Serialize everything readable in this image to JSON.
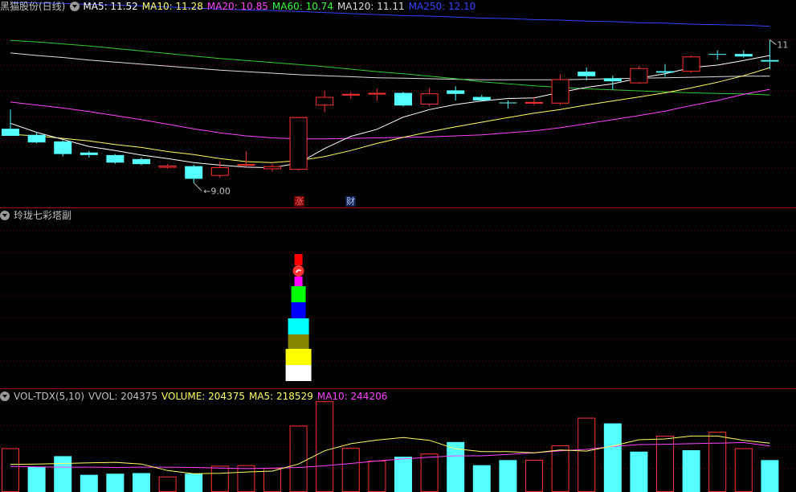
{
  "panels": {
    "price": {
      "title": "黑猫股份(日线)",
      "ma": [
        {
          "label": "MA5: 11.52",
          "color": "#ffffff"
        },
        {
          "label": "MA10: 11.28",
          "color": "#ffff66"
        },
        {
          "label": "MA20: 10.85",
          "color": "#ff44ff"
        },
        {
          "label": "MA60: 10.74",
          "color": "#33ff33"
        },
        {
          "label": "MA120: 11.11",
          "color": "#dddddd"
        },
        {
          "label": "MA250: 12.10",
          "color": "#3344ff"
        }
      ],
      "low_marker": "9.00",
      "high_marker": "11",
      "tag_zhang": "涨",
      "tag_cai": "财"
    },
    "tower": {
      "title": "玲珑七彩塔副"
    },
    "volume": {
      "title": "VOL-TDX(5,10)",
      "vvol": "VVOL: 204375",
      "volume": "VOLUME: 204375",
      "ma5": "MA5: 218529",
      "ma10": "MA10: 244206"
    }
  },
  "colors": {
    "up": "#ff3232",
    "down": "#54ffff",
    "grid": "#7a0000"
  },
  "chart_data": {
    "type": "candlestick",
    "ylim": [
      8.8,
      12.3
    ],
    "candles": [
      {
        "o": 10.07,
        "c": 9.93,
        "h": 10.45,
        "l": 9.93
      },
      {
        "o": 9.95,
        "c": 9.8,
        "h": 10.0,
        "l": 9.78
      },
      {
        "o": 9.82,
        "c": 9.57,
        "h": 9.84,
        "l": 9.52
      },
      {
        "o": 9.6,
        "c": 9.55,
        "h": 9.63,
        "l": 9.5
      },
      {
        "o": 9.55,
        "c": 9.4,
        "h": 9.57,
        "l": 9.38
      },
      {
        "o": 9.47,
        "c": 9.37,
        "h": 9.5,
        "l": 9.35
      },
      {
        "o": 9.3,
        "c": 9.34,
        "h": 9.37,
        "l": 9.28
      },
      {
        "o": 9.33,
        "c": 9.08,
        "h": 9.36,
        "l": 9.0
      },
      {
        "o": 9.14,
        "c": 9.31,
        "h": 9.42,
        "l": 9.1
      },
      {
        "o": 9.37,
        "c": 9.37,
        "h": 9.62,
        "l": 9.32
      },
      {
        "o": 9.27,
        "c": 9.33,
        "h": 9.37,
        "l": 9.23
      },
      {
        "o": 9.26,
        "c": 10.3,
        "h": 10.3,
        "l": 9.24
      },
      {
        "o": 10.53,
        "c": 10.7,
        "h": 10.82,
        "l": 10.4
      },
      {
        "o": 10.73,
        "c": 10.76,
        "h": 10.8,
        "l": 10.66
      },
      {
        "o": 10.75,
        "c": 10.78,
        "h": 10.86,
        "l": 10.63
      },
      {
        "o": 10.78,
        "c": 10.53,
        "h": 10.8,
        "l": 10.51
      },
      {
        "o": 10.55,
        "c": 10.77,
        "h": 10.87,
        "l": 10.52
      },
      {
        "o": 10.83,
        "c": 10.76,
        "h": 10.91,
        "l": 10.63
      },
      {
        "o": 10.7,
        "c": 10.63,
        "h": 10.74,
        "l": 10.61
      },
      {
        "o": 10.59,
        "c": 10.58,
        "h": 10.63,
        "l": 10.47
      },
      {
        "o": 10.57,
        "c": 10.6,
        "h": 10.7,
        "l": 10.54
      },
      {
        "o": 10.57,
        "c": 11.05,
        "h": 11.15,
        "l": 10.54
      },
      {
        "o": 11.2,
        "c": 11.11,
        "h": 11.28,
        "l": 11.03
      },
      {
        "o": 11.07,
        "c": 11.01,
        "h": 11.12,
        "l": 10.84
      },
      {
        "o": 10.97,
        "c": 11.27,
        "h": 11.31,
        "l": 10.96
      },
      {
        "o": 11.21,
        "c": 11.18,
        "h": 11.35,
        "l": 11.1
      },
      {
        "o": 11.2,
        "c": 11.5,
        "h": 11.52,
        "l": 11.18
      },
      {
        "o": 11.55,
        "c": 11.54,
        "h": 11.62,
        "l": 11.44
      },
      {
        "o": 11.55,
        "c": 11.5,
        "h": 11.62,
        "l": 11.48
      },
      {
        "o": 11.43,
        "c": 11.4,
        "h": 11.83,
        "l": 11.25
      }
    ],
    "ma5": [
      10.18,
      10.0,
      9.86,
      9.72,
      9.64,
      9.55,
      9.48,
      9.4,
      9.35,
      9.31,
      9.3,
      9.39,
      9.68,
      9.92,
      10.06,
      10.3,
      10.45,
      10.55,
      10.62,
      10.67,
      10.68,
      10.79,
      10.89,
      10.96,
      11.07,
      11.16,
      11.28,
      11.33,
      11.42,
      11.52
    ],
    "ma10": [
      9.96,
      9.93,
      9.88,
      9.83,
      9.76,
      9.7,
      9.62,
      9.56,
      9.48,
      9.42,
      9.4,
      9.44,
      9.52,
      9.64,
      9.78,
      9.9,
      10.01,
      10.11,
      10.2,
      10.29,
      10.38,
      10.45,
      10.54,
      10.62,
      10.7,
      10.78,
      10.88,
      10.99,
      11.12,
      11.28
    ],
    "ma20": [
      10.6,
      10.54,
      10.48,
      10.41,
      10.33,
      10.25,
      10.16,
      10.07,
      9.99,
      9.93,
      9.89,
      9.87,
      9.87,
      9.88,
      9.89,
      9.9,
      9.91,
      9.93,
      9.95,
      9.99,
      10.03,
      10.09,
      10.17,
      10.25,
      10.33,
      10.42,
      10.53,
      10.63,
      10.75,
      10.85
    ],
    "ma60": [
      11.82,
      11.79,
      11.75,
      11.71,
      11.66,
      11.61,
      11.56,
      11.51,
      11.46,
      11.42,
      11.38,
      11.34,
      11.3,
      11.25,
      11.2,
      11.16,
      11.11,
      11.06,
      11.0,
      10.96,
      10.92,
      10.89,
      10.86,
      10.84,
      10.82,
      10.8,
      10.78,
      10.77,
      10.76,
      10.74
    ],
    "ma120": [
      11.57,
      11.52,
      11.48,
      11.43,
      11.39,
      11.35,
      11.31,
      11.27,
      11.23,
      11.2,
      11.17,
      11.14,
      11.12,
      11.1,
      11.08,
      11.07,
      11.06,
      11.05,
      11.04,
      11.04,
      11.04,
      11.04,
      11.05,
      11.06,
      11.07,
      11.08,
      11.09,
      11.1,
      11.11,
      11.11
    ],
    "ma250": [
      12.57,
      12.56,
      12.55,
      12.53,
      12.52,
      12.5,
      12.48,
      12.46,
      12.44,
      12.42,
      12.41,
      12.39,
      12.37,
      12.35,
      12.33,
      12.31,
      12.3,
      12.28,
      12.26,
      12.25,
      12.23,
      12.22,
      12.2,
      12.19,
      12.17,
      12.16,
      12.14,
      12.13,
      12.12,
      12.1
    ],
    "volume": {
      "ylim": [
        0,
        310000
      ],
      "values": [
        152000,
        86000,
        124000,
        58000,
        62000,
        64000,
        52000,
        62000,
        90000,
        92000,
        82000,
        232000,
        318000,
        153000,
        108000,
        122000,
        133000,
        174000,
        92000,
        110000,
        111000,
        162000,
        260000,
        240000,
        140000,
        196000,
        145000,
        210000,
        152000,
        110000
      ],
      "up": [
        true,
        false,
        false,
        false,
        false,
        false,
        true,
        false,
        true,
        true,
        true,
        true,
        true,
        true,
        true,
        false,
        true,
        false,
        false,
        false,
        true,
        true,
        true,
        false,
        false,
        true,
        false,
        true,
        true,
        false
      ],
      "ma5": [
        95000,
        96000,
        98000,
        100000,
        102000,
        96000,
        73000,
        62000,
        63000,
        68000,
        71000,
        96000,
        143000,
        168000,
        181000,
        190000,
        180000,
        150000,
        140000,
        140000,
        136000,
        146000,
        142000,
        160000,
        182000,
        185000,
        195000,
        195000,
        180000,
        170000
      ],
      "ma10": [
        88000,
        86000,
        85000,
        85000,
        84000,
        85000,
        85000,
        84000,
        82000,
        80000,
        82000,
        84000,
        90000,
        98000,
        107000,
        114000,
        120000,
        125000,
        125000,
        130000,
        136000,
        143000,
        148000,
        158000,
        165000,
        166000,
        168000,
        170000,
        172000,
        160000
      ]
    }
  },
  "tower_blocks": [
    {
      "color": "#ffffff",
      "w": 32,
      "h": 20
    },
    {
      "color": "#ffff00",
      "w": 32,
      "h": 20
    },
    {
      "color": "#888800",
      "w": 26,
      "h": 18
    },
    {
      "color": "#00ffff",
      "w": 26,
      "h": 20
    },
    {
      "color": "#0000ff",
      "w": 18,
      "h": 20
    },
    {
      "color": "#00ff00",
      "w": 18,
      "h": 20
    },
    {
      "color": "#ff00ff",
      "w": 10,
      "h": 12
    },
    {
      "color": "#ff3333",
      "w": 10,
      "h": 14,
      "round": true
    },
    {
      "color": "#ff0000",
      "w": 10,
      "h": 14
    }
  ]
}
